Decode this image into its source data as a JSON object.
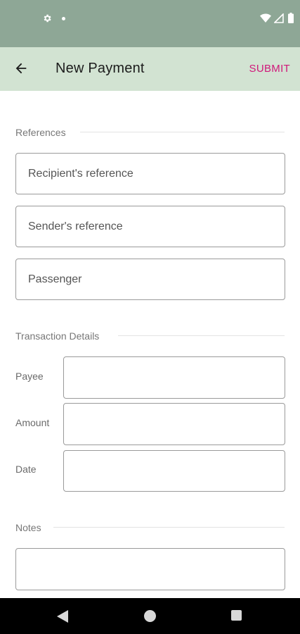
{
  "app_bar": {
    "title": "New Payment",
    "submit_label": "SUBMIT"
  },
  "sections": {
    "references": {
      "label": "References",
      "fields": [
        {
          "placeholder": "Recipient's reference"
        },
        {
          "placeholder": "Sender's reference"
        },
        {
          "placeholder": "Passenger"
        }
      ]
    },
    "transaction": {
      "label": "Transaction Details",
      "rows": [
        {
          "label": "Payee",
          "value": ""
        },
        {
          "label": "Amount",
          "value": ""
        },
        {
          "label": "Date",
          "value": ""
        }
      ]
    },
    "notes": {
      "label": "Notes",
      "value": ""
    }
  },
  "colors": {
    "status_bar": "#8ea796",
    "app_bar": "#d2e3d2",
    "accent": "#d0187a"
  },
  "icons": {
    "status": [
      "gear-icon",
      "dot-icon",
      "wifi-icon",
      "cell-signal-icon",
      "battery-icon"
    ],
    "nav": [
      "back-triangle-icon",
      "home-circle-icon",
      "recents-square-icon"
    ]
  }
}
